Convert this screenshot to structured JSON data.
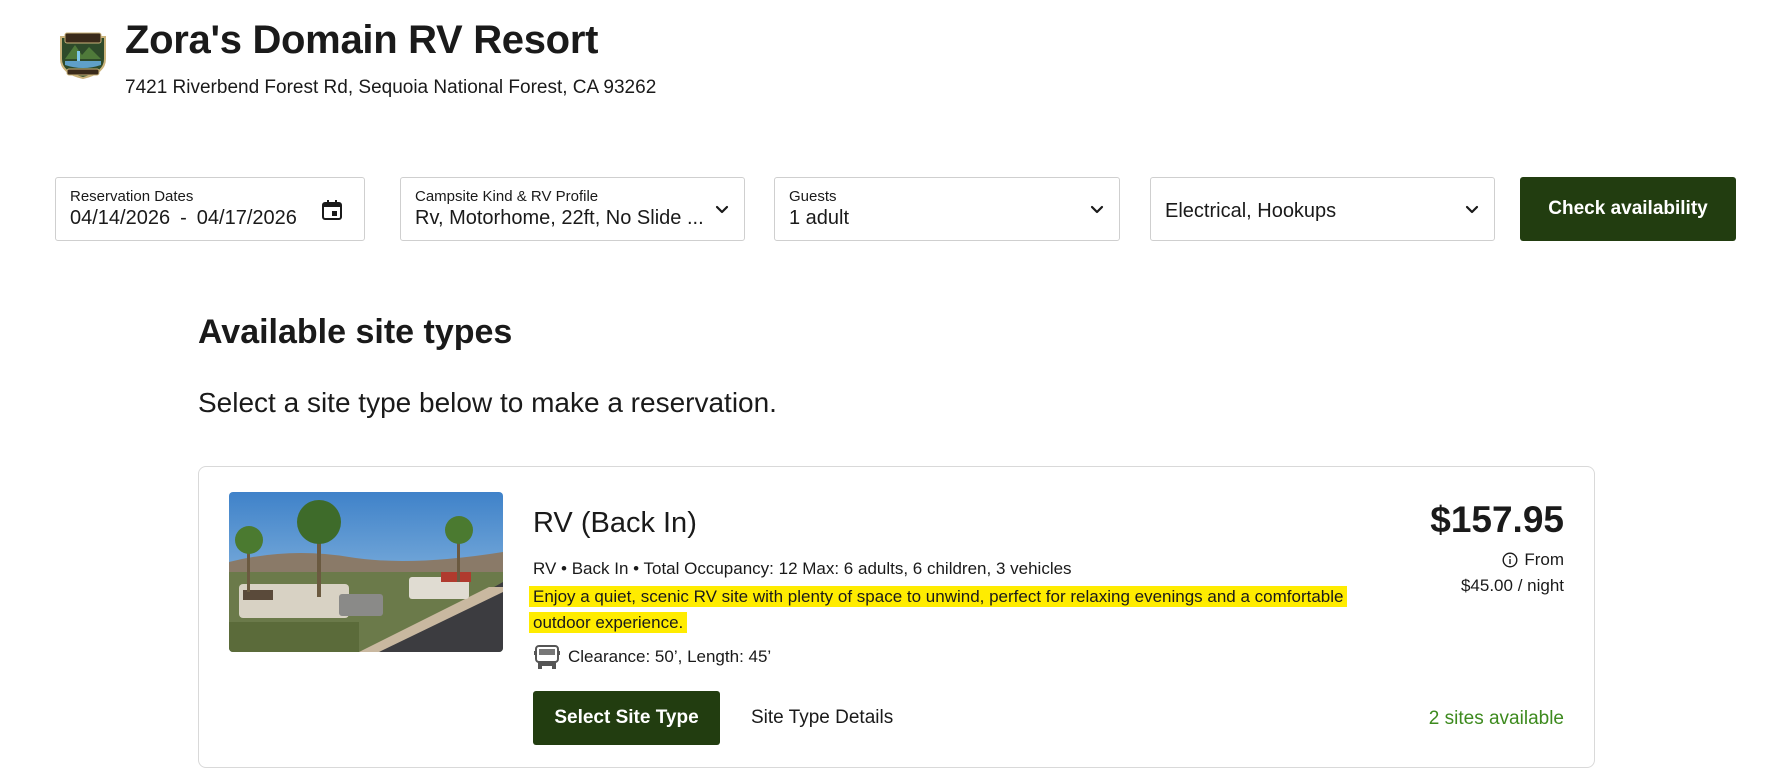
{
  "header": {
    "title": "Zora's Domain RV Resort",
    "address": "7421 Riverbend Forest Rd, Sequoia National Forest, CA 93262",
    "logo_icon": "zoras-domain-campground-logo"
  },
  "search": {
    "dates": {
      "label": "Reservation Dates",
      "start": "04/14/2026",
      "separator": "-",
      "end": "04/17/2026",
      "icon": "calendar-icon"
    },
    "campsite": {
      "label": "Campsite Kind & RV Profile",
      "value": "Rv, Motorhome, 22ft, No Slide ..."
    },
    "guests": {
      "label": "Guests",
      "value": "1 adult"
    },
    "amenities": {
      "value": "Electrical, Hookups"
    },
    "check_label": "Check availability"
  },
  "content": {
    "heading": "Available site types",
    "subheading": "Select a site type below to make a reservation."
  },
  "site": {
    "name": "RV (Back In)",
    "meta": "RV • Back In • Total Occupancy: 12 Max: 6 adults, 6 children, 3 vehicles",
    "description": "Enjoy a quiet, scenic RV site with plenty of space to unwind, perfect for relaxing evenings and a comfortable outdoor experience.",
    "clearance": "Clearance: 50’, Length: 45’",
    "price": "$157.95",
    "from_label": "From",
    "per_night": "$45.00 / night",
    "select_label": "Select Site Type",
    "details_label": "Site Type Details",
    "availability": "2 sites available"
  },
  "colors": {
    "brand_green": "#223d10",
    "available_green": "#3d8a1e",
    "highlight": "#ffec00"
  }
}
